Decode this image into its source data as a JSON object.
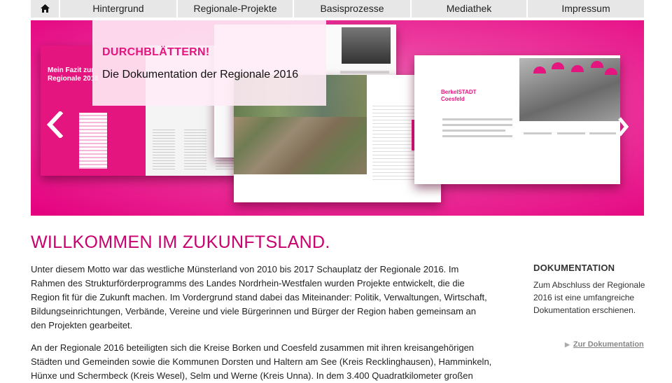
{
  "nav": {
    "home_icon": "home-icon",
    "items": [
      "Hintergrund",
      "Regionale-Projekte",
      "Basisprozesse",
      "Mediathek",
      "Impressum"
    ]
  },
  "hero": {
    "overlay_heading": "DURCHBLÄTTERN!",
    "overlay_subtitle": "Die Dokumentation der Regionale 2016",
    "book1_title": "Mein Fazit zur Regionale 2016",
    "book4_title": "BerkelSTADT Coesfeld",
    "accent_color": "#e4157f",
    "prev_icon": "chevron-left-icon",
    "next_icon": "chevron-right-icon"
  },
  "main": {
    "heading": "WILLKOMMEN IM ZUKUNFTSLAND.",
    "paragraph1": "Unter diesem Motto war das westliche Münsterland von 2010 bis 2017 Schauplatz der Regionale 2016. Im Rahmen des Strukturförderprogramms des Landes Nordrhein-Westfalen wurden Projekte entwickelt, die die Region fit für die Zukunft machen. Im Vordergrund stand dabei das Miteinander: Politik, Verwaltungen, Wirtschaft, Bildungseinrichtungen, Verbände, Vereine und viele Bürgerinnen und Bürger der Region haben gemeinsam an den Projekten gearbeitet.",
    "paragraph2": "An der Regionale 2016 beteiligten sich die Kreise Borken und Coesfeld zusammen mit ihren kreisangehörigen Städten und Gemeinden sowie die Kommunen Dorsten und Haltern am See (Kreis Recklinghausen), Hamminkeln, Hünxe und Schermbeck (Kreis Wesel), Selm und Werne (Kreis Unna). In dem 3.400 Quadratkilometer großen"
  },
  "sidebar": {
    "heading": "DOKUMENTATION",
    "text": "Zum Abschluss der Regionale 2016 ist eine umfangreiche Dokumentation erschienen.",
    "link": "Zur Dokumentation"
  }
}
